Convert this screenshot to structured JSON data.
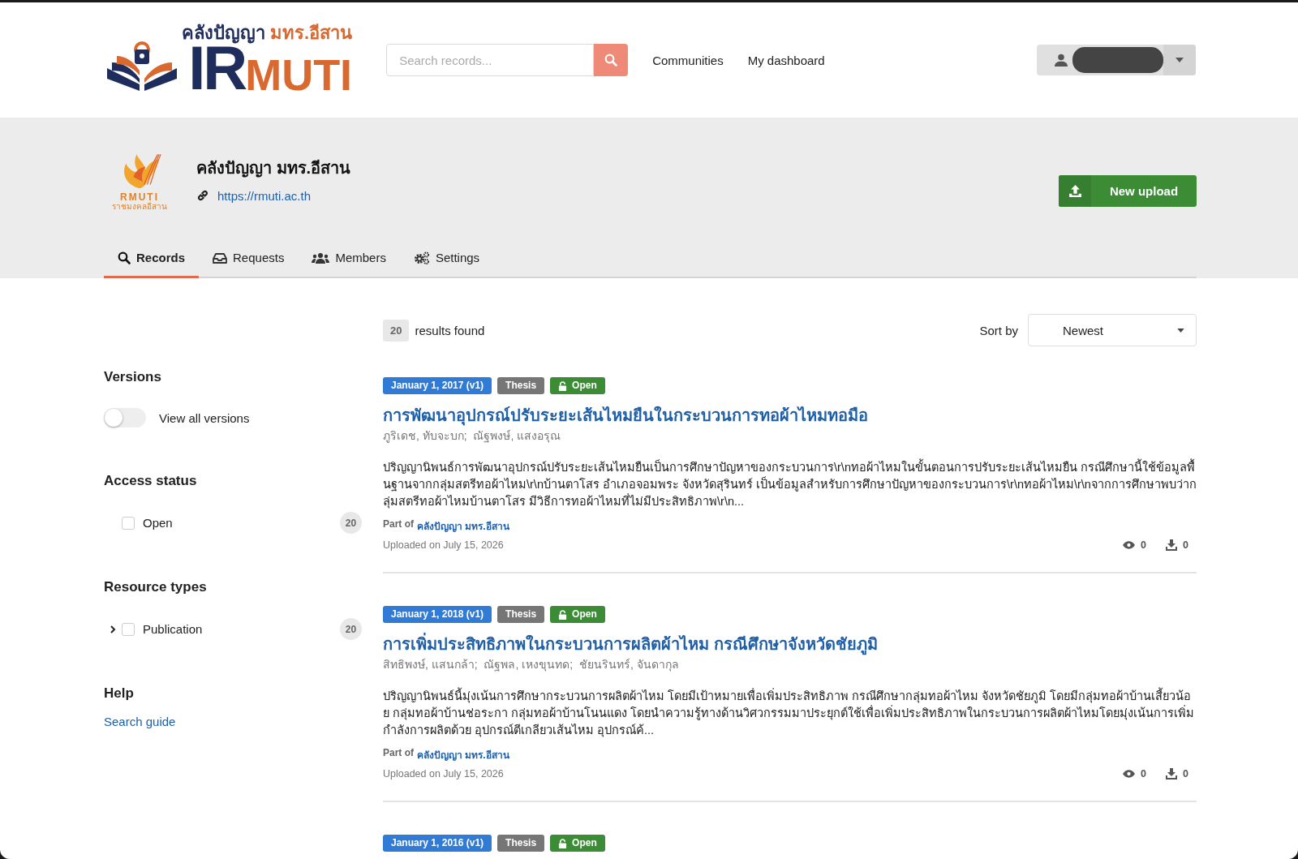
{
  "header": {
    "logo": {
      "title_part_1": "คลังปัญญา",
      "title_part_2": "มทร.อีสาน",
      "ir": "IR",
      "muti": "MUTI"
    },
    "search": {
      "placeholder": "Search records..."
    },
    "nav": [
      "Communities",
      "My dashboard"
    ]
  },
  "community": {
    "logo_text": "RMUTI",
    "logo_subtext": "ราชมงคลอีสาน",
    "name": "คลังปัญญา มทร.อีสาน",
    "url": "https://rmuti.ac.th",
    "upload_button": "New upload"
  },
  "tabs": [
    {
      "label": "Records",
      "kind": "search",
      "selected": true
    },
    {
      "label": "Requests",
      "kind": "inbox",
      "selected": false
    },
    {
      "label": "Members",
      "kind": "users",
      "selected": false
    },
    {
      "label": "Settings",
      "kind": "cogs",
      "selected": false
    }
  ],
  "sidebar": {
    "versions": {
      "title": "Versions",
      "toggle_label": "View all versions",
      "on": false
    },
    "access_status": {
      "title": "Access status",
      "items": [
        {
          "label": "Open",
          "count": "20",
          "checked": false
        }
      ]
    },
    "resource_types": {
      "title": "Resource types",
      "items": [
        {
          "label": "Publication",
          "count": "20",
          "checked": false,
          "expanded": false
        }
      ]
    },
    "help": {
      "title": "Help",
      "link": "Search guide"
    }
  },
  "results": {
    "count": "20",
    "label": "results found",
    "sort_label": "Sort by",
    "sort_value": "Newest"
  },
  "records": [
    {
      "date": "January 1, 2017 (v1)",
      "type": "Thesis",
      "access": "Open",
      "title": "การพัฒนาอุปกรณ์ปรับระยะเส้นไหมยืนในกระบวนการทอผ้าไหมทอมือ",
      "creators": "ภูริเดช, ทับจะบก;  ณัฐพงษ์, แสงอรุณ",
      "description": "ปริญญานิพนธ์การพัฒนาอุปกรณ์ปรับระยะเส้นไหมยืนเป็นการศึกษาปัญหาของกระบวนการ\\r\\nทอผ้าไหมในขั้นตอนการปรับระยะเส้นไหมยืน กรณีศึกษานี้ใช้ข้อมูลพื้นฐานจากกลุ่มสตรีทอผ้าไหม\\r\\nบ้านตาโสร อำเภอจอมพระ จังหวัดสุรินทร์ เป็นข้อมูลสำหรับการศึกษาปัญหาของกระบวนการ\\r\\nทอผ้าไหม\\r\\nจากการศึกษาพบว่ากลุ่มสตรีทอผ้าไหมบ้านตาโสร มีวิธีการทอผ้าไหมที่ไม่มีประสิทธิภาพ\\r\\n...",
      "part_of_label": "Part of",
      "part_of": "คลังปัญญา มทร.อีสาน",
      "uploaded": "Uploaded on July 15, 2026",
      "views": "0",
      "downloads": "0"
    },
    {
      "date": "January 1, 2018 (v1)",
      "type": "Thesis",
      "access": "Open",
      "title": "การเพิ่มประสิทธิภาพในกระบวนการผลิตผ้าไหม กรณีศึกษาจังหวัดชัยภูมิ",
      "creators": "สิทธิพงษ์, แสนกล้า;  ณัฐพล, เหงขุนทด;  ชัยนรินทร์, จันดากุล",
      "description": "ปริญญานิพนธ์นี้มุ่งเน้นการศึกษากระบวนการผลิตผ้าไหม โดยมีเป้าหมายเพื่อเพิ่มประสิทธิภาพ กรณีศึกษากลุ่มทอผ้าไหม จังหวัดชัยภูมิ โดยมีกลุ่มทอผ้าบ้านเสี้ยวน้อย กลุ่มทอผ้าบ้านช่อระกา กลุ่มทอผ้าบ้านโนนแดง โดยนำความรู้ทางด้านวิศวกรรมมาประยุกต์ใช้เพื่อเพิ่มประสิทธิภาพในกระบวนการผลิตผ้าไหมโดยมุ่งเน้นการเพิ่มกำลังการผลิตด้วย อุปกรณ์ตีเกลียวเส้นไหม อุปกรณ์ค้...",
      "part_of_label": "Part of",
      "part_of": "คลังปัญญา มทร.อีสาน",
      "uploaded": "Uploaded on July 15, 2026",
      "views": "0",
      "downloads": "0"
    },
    {
      "date": "January 1, 2016 (v1)",
      "type": "Thesis",
      "access": "Open"
    }
  ]
}
